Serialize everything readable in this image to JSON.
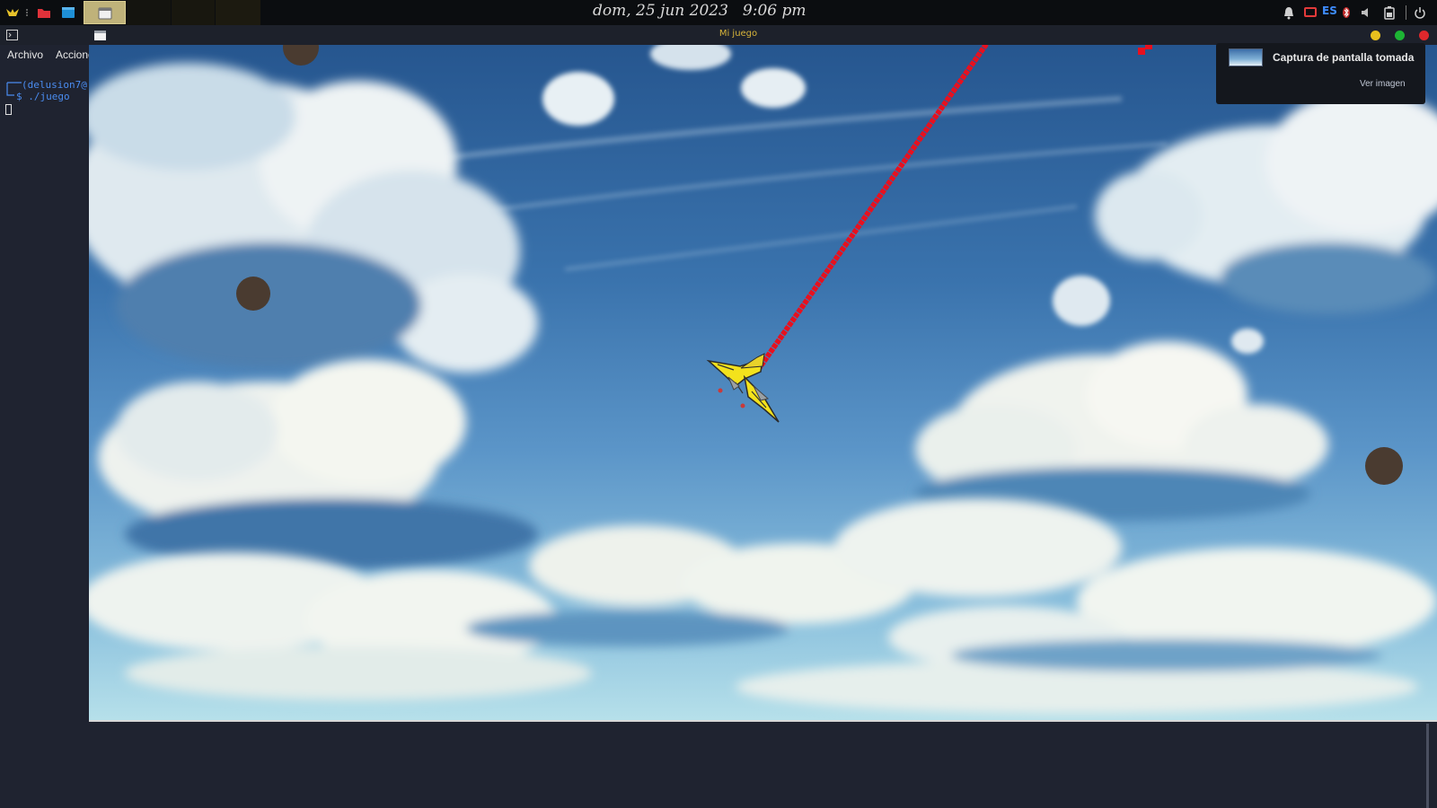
{
  "panel": {
    "date": "dom, 25 jun 2023",
    "time": "9:06 pm",
    "keyboard_layout": "ES",
    "icons": [
      "kali-menu-icon",
      "file-manager-icon",
      "terminal-icon",
      "active-window-icon",
      "notification-bell-icon",
      "screen-record-icon",
      "keyboard-layout-indicator",
      "bluetooth-icon",
      "volume-icon",
      "battery-icon",
      "power-icon"
    ]
  },
  "window": {
    "title": "Mi juego",
    "colors": {
      "title": "#d7b43a",
      "minimize": "#e8c01e",
      "maximize": "#1db534",
      "close": "#e0282c"
    }
  },
  "terminal": {
    "menu": [
      "Archivo",
      "Acciones"
    ],
    "prompt_user": "(delusion7@",
    "command": "$ ./juego"
  },
  "game": {
    "sprite": "yellow-bird-plane",
    "laser_color": "#e8101e",
    "enemy_color": "#4a3b30"
  },
  "notification": {
    "title": "Captura de pantalla tomada",
    "action": "Ver imagen"
  }
}
